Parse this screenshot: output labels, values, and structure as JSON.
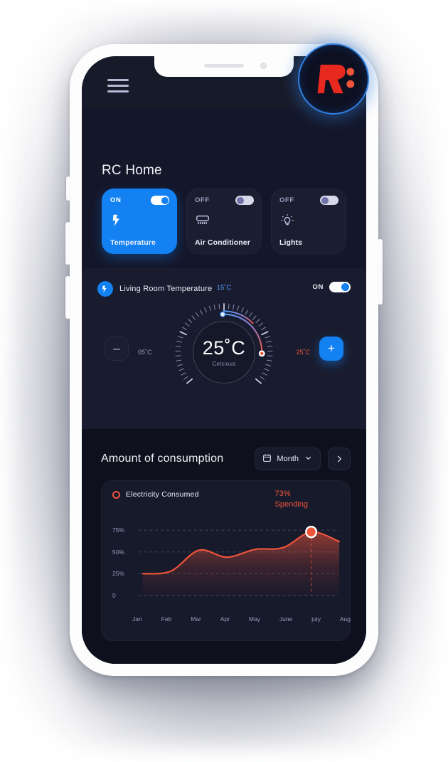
{
  "app": {
    "topbar": {
      "menu_icon": "hamburger-menu-icon"
    },
    "logo": {
      "letter": "R",
      "icon_name": "rc-logo-badge",
      "brand_red": "#e8291f",
      "ring_blue": "#2f7fe0"
    },
    "page_title": "RC Home"
  },
  "devices": [
    {
      "state": "ON",
      "name": "Temperature",
      "icon": "bolt-icon",
      "active": true,
      "toggle_on": true
    },
    {
      "state": "OFF",
      "name": "Air Conditioner",
      "icon": "air-conditioner-icon",
      "active": false,
      "toggle_on": false
    },
    {
      "state": "OFF",
      "name": "Lights",
      "icon": "lightbulb-icon",
      "active": false,
      "toggle_on": false
    }
  ],
  "thermostat": {
    "badge_icon": "bolt-icon",
    "title": "Living Room Temperature",
    "toggle_label": "ON",
    "toggle_on": true,
    "value": "25˚C",
    "unit_label": "Celcious",
    "top_label": "15˚C",
    "left_label": "05˚C",
    "right_label": "25˚C",
    "minus_label": "–",
    "plus_label": "+",
    "accent_blue": "#4f9dfb",
    "accent_red": "#f0543b"
  },
  "consumption": {
    "title": "Amount of consumption",
    "period": {
      "label": "Month",
      "icon": "calendar-icon",
      "chevron": "chevron-down-icon"
    },
    "next_arrow": "›"
  },
  "chart_data": {
    "type": "area",
    "title": "Electricity Consumed",
    "legend": [
      "Electricity Consumed"
    ],
    "legend_position": "top-left",
    "annotation": {
      "value": "73%",
      "label": "Spending",
      "at_category": "july"
    },
    "categories": [
      "Jan",
      "Feb",
      "Mar",
      "Apr",
      "May",
      "June",
      "july",
      "Aug"
    ],
    "values": [
      25,
      28,
      52,
      44,
      53,
      55,
      73,
      62
    ],
    "series": [
      {
        "name": "Electricity Consumed",
        "values": [
          25,
          28,
          52,
          44,
          53,
          55,
          73,
          62
        ],
        "color": "#f0543b"
      }
    ],
    "ylabel": "",
    "xlabel": "",
    "ylim": [
      0,
      85
    ],
    "yticks": [
      "0",
      "25%",
      "50%",
      "75%"
    ],
    "ytick_values": [
      0,
      25,
      50,
      75
    ],
    "grid": true,
    "marker": {
      "category": "july",
      "value": 73,
      "color": "#f0543b"
    }
  }
}
